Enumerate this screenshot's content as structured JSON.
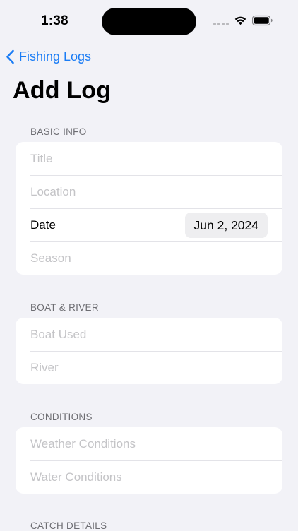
{
  "status_bar": {
    "time": "1:38"
  },
  "nav": {
    "back_label": "Fishing Logs",
    "back_icon": "chevron-left-icon",
    "accent_color": "#1a7cf5"
  },
  "page": {
    "title": "Add Log"
  },
  "sections": {
    "basic_info": {
      "header": "BASIC INFO",
      "title_placeholder": "Title",
      "location_placeholder": "Location",
      "date_label": "Date",
      "date_value": "Jun 2, 2024",
      "season_placeholder": "Season"
    },
    "boat_river": {
      "header": "BOAT & RIVER",
      "boat_placeholder": "Boat Used",
      "river_placeholder": "River"
    },
    "conditions": {
      "header": "CONDITIONS",
      "weather_placeholder": "Weather Conditions",
      "water_placeholder": "Water Conditions"
    },
    "catch_details": {
      "header": "CATCH DETAILS"
    }
  }
}
